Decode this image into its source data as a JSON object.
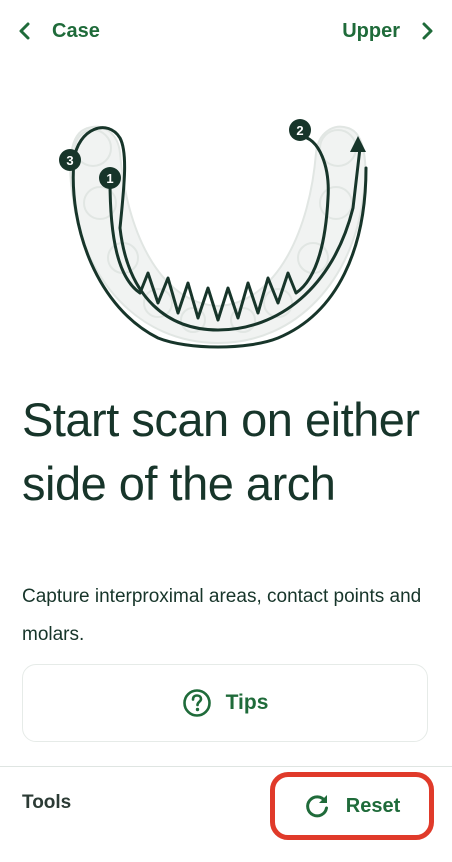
{
  "header": {
    "back_label": "Case",
    "next_label": "Upper"
  },
  "illustration": {
    "steps": [
      "1",
      "2",
      "3"
    ]
  },
  "main": {
    "title": "Start scan on either side of the arch",
    "description": "Capture interproximal areas, contact points and molars."
  },
  "tips": {
    "label": "Tips"
  },
  "footer": {
    "tools_label": "Tools",
    "reset_label": "Reset"
  },
  "colors": {
    "brand_green": "#1f6b3a",
    "text_dark": "#17352a",
    "highlight_red": "#e03a2a"
  }
}
